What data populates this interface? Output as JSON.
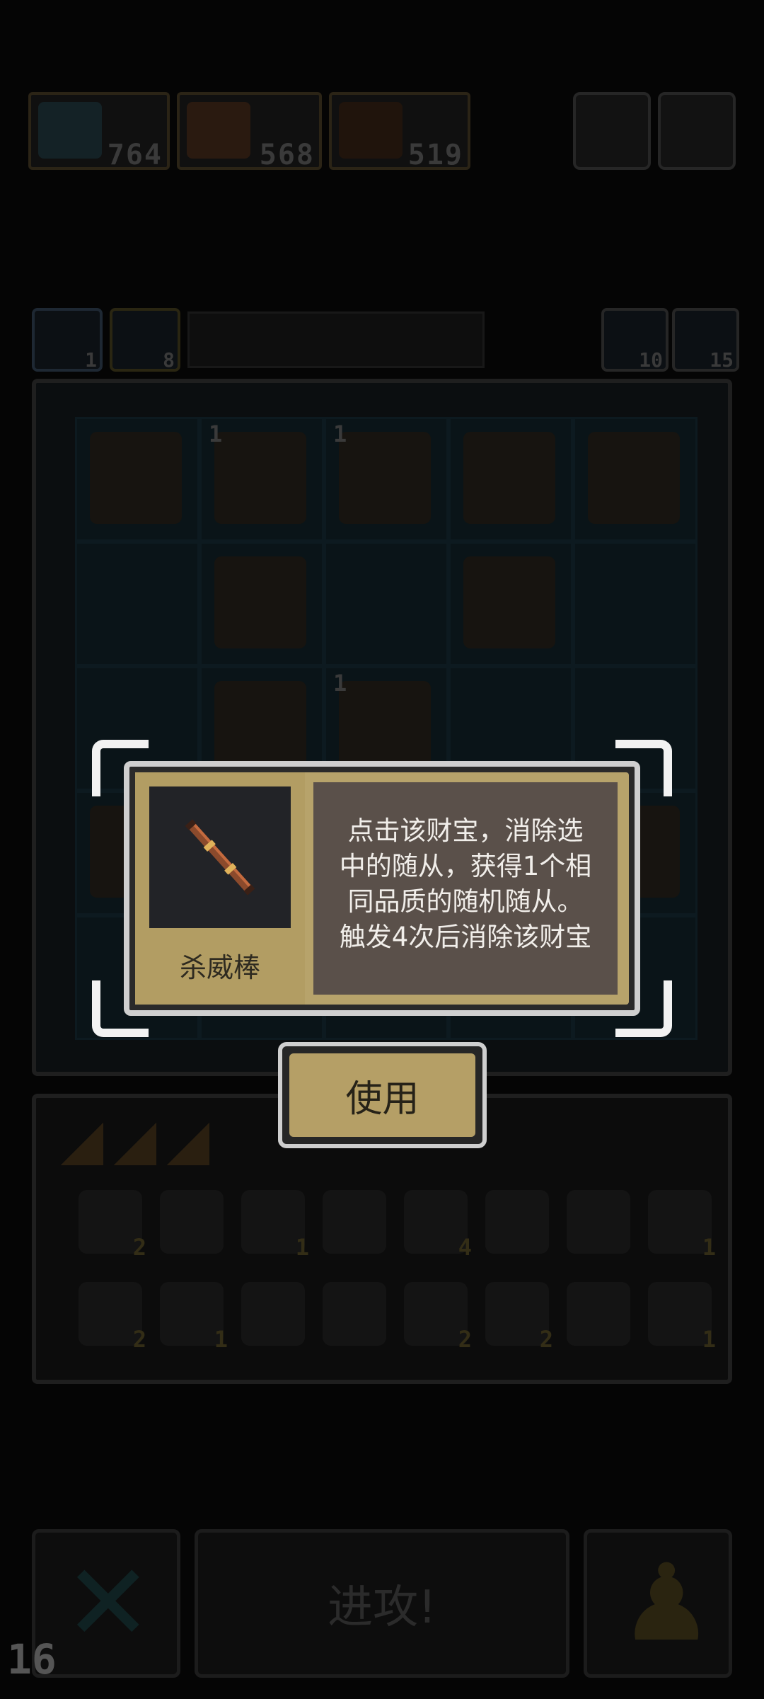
{
  "resources": [
    {
      "name": "resource-1",
      "value": "764"
    },
    {
      "name": "resource-2",
      "value": "568"
    },
    {
      "name": "resource-3",
      "value": "519"
    }
  ],
  "sub_badges": [
    {
      "value": "1"
    },
    {
      "value": "8"
    }
  ],
  "right_badges": [
    {
      "value": "10"
    },
    {
      "value": "15"
    }
  ],
  "board": {
    "rows": 5,
    "cols": 5,
    "cell_levels": [
      "",
      "1",
      "1",
      "",
      "",
      "",
      "",
      "",
      "",
      "",
      "",
      "",
      "1",
      "",
      ""
    ]
  },
  "dialog": {
    "item_name": "杀威棒",
    "description_lines": [
      "点击该财宝，消除选",
      "中的随从，获得1个相",
      "同品质的随机随从。",
      "触发4次后消除该财宝"
    ],
    "use_button": "使用"
  },
  "inventory": {
    "slot_counts_row1": [
      "2",
      "",
      "1",
      "",
      "4",
      "",
      "",
      "1"
    ],
    "slot_counts_row2": [
      "2",
      "1",
      "",
      "",
      "2",
      "2",
      "",
      "1"
    ]
  },
  "bottom": {
    "attack_label": "进攻!",
    "level": "16"
  },
  "colors": {
    "dialog_gold": "#b7a36b",
    "dialog_text_bg": "#5a504a",
    "dialog_border": "#cfcfcf"
  }
}
